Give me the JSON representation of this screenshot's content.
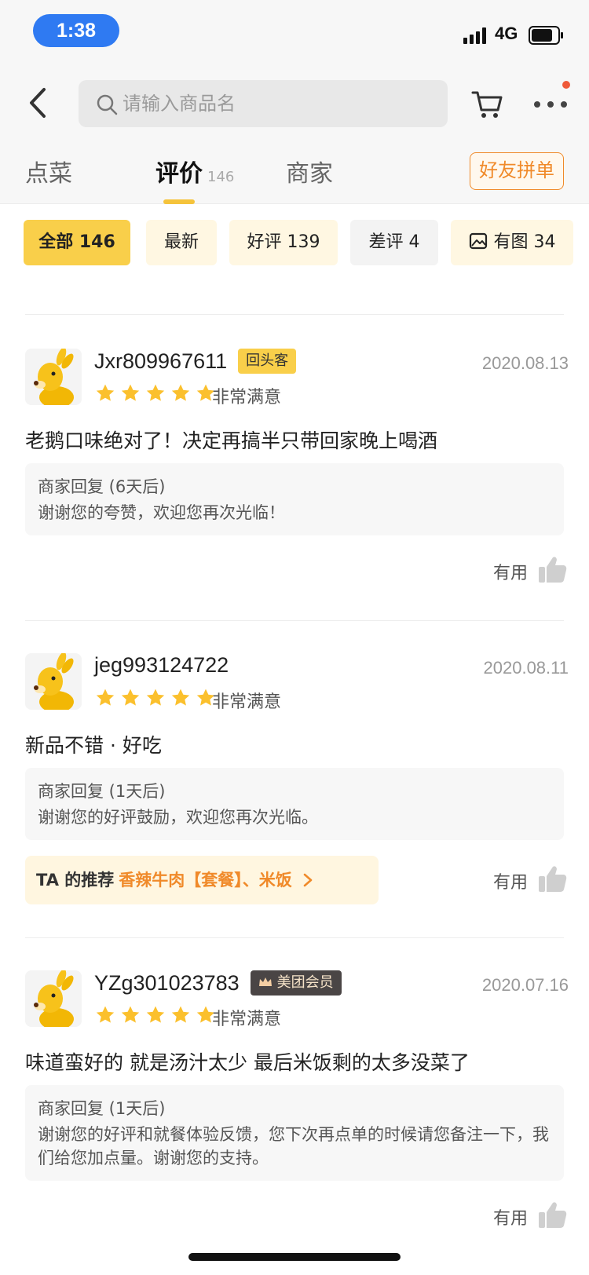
{
  "status_bar": {
    "time": "1:38",
    "network": "4G"
  },
  "search": {
    "placeholder": "请输入商品名"
  },
  "tabs": [
    {
      "label": "点菜"
    },
    {
      "label": "评价",
      "count": "146"
    },
    {
      "label": "商家"
    }
  ],
  "group_order_label": "好友拼单",
  "filters": [
    {
      "label": "全部 146"
    },
    {
      "label": "最新"
    },
    {
      "label": "好评 139"
    },
    {
      "label": "差评 4"
    },
    {
      "label": "有图 34"
    }
  ],
  "useful_label": "有用",
  "reviews": [
    {
      "username": "Jxr809967611",
      "badge": "回头客",
      "date": "2020.08.13",
      "rating": 5,
      "rating_text": "非常满意",
      "text": "老鹅口味绝对了！决定再搞半只带回家晚上喝酒",
      "reply_title": "商家回复 (6天后)",
      "reply_text": "谢谢您的夸赞，欢迎您再次光临！"
    },
    {
      "username": "jeg993124722",
      "date": "2020.08.11",
      "rating": 5,
      "rating_text": "非常满意",
      "text": "新品不错 · 好吃",
      "reply_title": "商家回复 (1天后)",
      "reply_text": "谢谢您的好评鼓励，欢迎您再次光临。",
      "recommend_label": "TA 的推荐",
      "recommend_items": "香辣牛肉【套餐】、米饭"
    },
    {
      "username": "YZg301023783",
      "badge": "美团会员",
      "date": "2020.07.16",
      "rating": 5,
      "rating_text": "非常满意",
      "text": "味道蛮好的 就是汤汁太少 最后米饭剩的太多没菜了",
      "reply_title": "商家回复 (1天后)",
      "reply_text": "谢谢您的好评和就餐体验反馈，您下次再点单的时候请您备注一下，我们给您加点量。谢谢您的支持。"
    }
  ],
  "colors": {
    "accent_yellow": "#f9cf4a",
    "accent_orange": "#f08a2a",
    "status_pill": "#2f7af2"
  }
}
